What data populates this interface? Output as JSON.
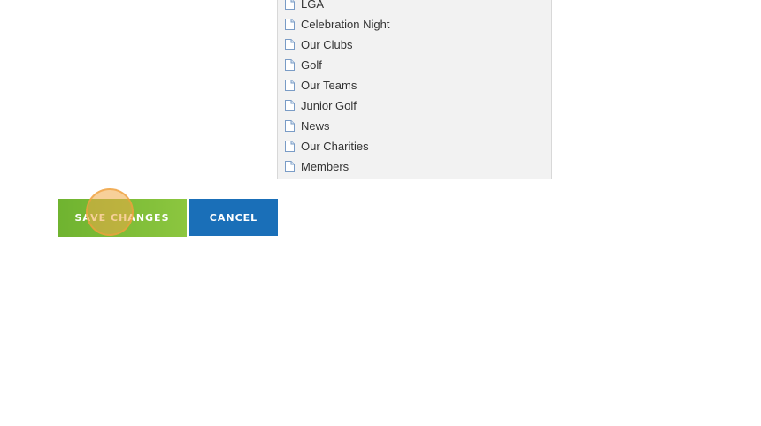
{
  "page_list": {
    "items": [
      {
        "label": "LGA",
        "icon": "document-icon"
      },
      {
        "label": "Celebration Night",
        "icon": "document-icon"
      },
      {
        "label": "Our Clubs",
        "icon": "document-icon"
      },
      {
        "label": "Golf",
        "icon": "document-icon"
      },
      {
        "label": "Our Teams",
        "icon": "document-icon"
      },
      {
        "label": "Junior Golf",
        "icon": "document-icon"
      },
      {
        "label": "News",
        "icon": "document-icon"
      },
      {
        "label": "Our Charities",
        "icon": "document-icon"
      },
      {
        "label": "Members",
        "icon": "document-icon"
      }
    ]
  },
  "actions": {
    "save_label": "SAVE CHANGES",
    "cancel_label": "CANCEL"
  },
  "colors": {
    "save_button": "#8cc63f",
    "cancel_button": "#1a6fb8",
    "panel_background": "#f2f2f2",
    "click_marker": "#f0aa46"
  }
}
